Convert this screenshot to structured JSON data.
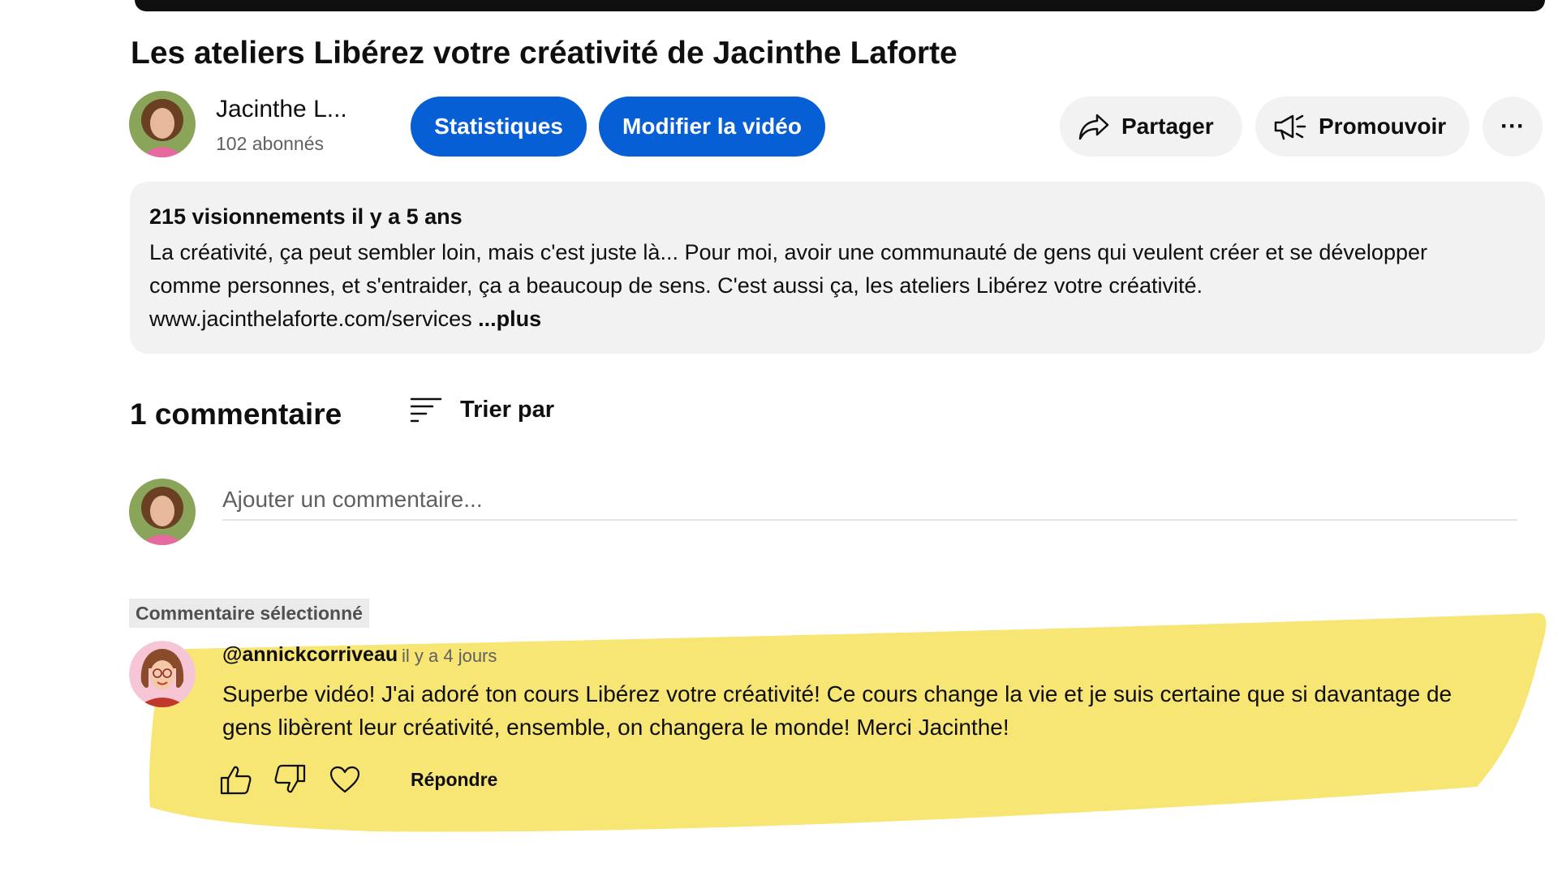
{
  "video": {
    "title": "Les ateliers Libérez votre créativité de Jacinthe Laforte"
  },
  "channel": {
    "name": "Jacinthe L...",
    "subscribers": "102 abonnés"
  },
  "actions": {
    "stats_label": "Statistiques",
    "edit_label": "Modifier la vidéo",
    "share_label": "Partager",
    "promote_label": "Promouvoir",
    "more_label": "···"
  },
  "description": {
    "meta": "215 visionnements  il y a 5 ans",
    "line1": "La créativité, ça peut sembler loin, mais c'est juste là... Pour moi, avoir une communauté de gens qui veulent créer et se développer",
    "line2": "comme personnes, et s'entraider, ça a beaucoup de sens. C'est aussi ça, les ateliers Libérez votre créativité.",
    "line3": "www.jacinthelaforte.com/services ",
    "more": "...plus"
  },
  "comments": {
    "count_label": "1 commentaire",
    "sort_label": "Trier par",
    "add_placeholder": "Ajouter un commentaire...",
    "selected_badge": "Commentaire sélectionné",
    "items": [
      {
        "author": "@annickcorriveau",
        "time": "il y a 4 jours",
        "line1": "Superbe vidéo! J'ai adoré ton cours Libérez votre créativité! Ce cours change la vie et je suis certaine que si davantage de",
        "line2": "gens libèrent leur créativité, ensemble, on changera le monde! Merci Jacinthe!",
        "reply_label": "Répondre"
      }
    ]
  },
  "colors": {
    "primary_button": "#065fd4",
    "highlight": "#f7e574",
    "chip_background": "#f2f2f2"
  },
  "icons": [
    "share-icon",
    "promote-icon",
    "more-icon",
    "sort-icon",
    "like-icon",
    "dislike-icon",
    "heart-icon"
  ]
}
